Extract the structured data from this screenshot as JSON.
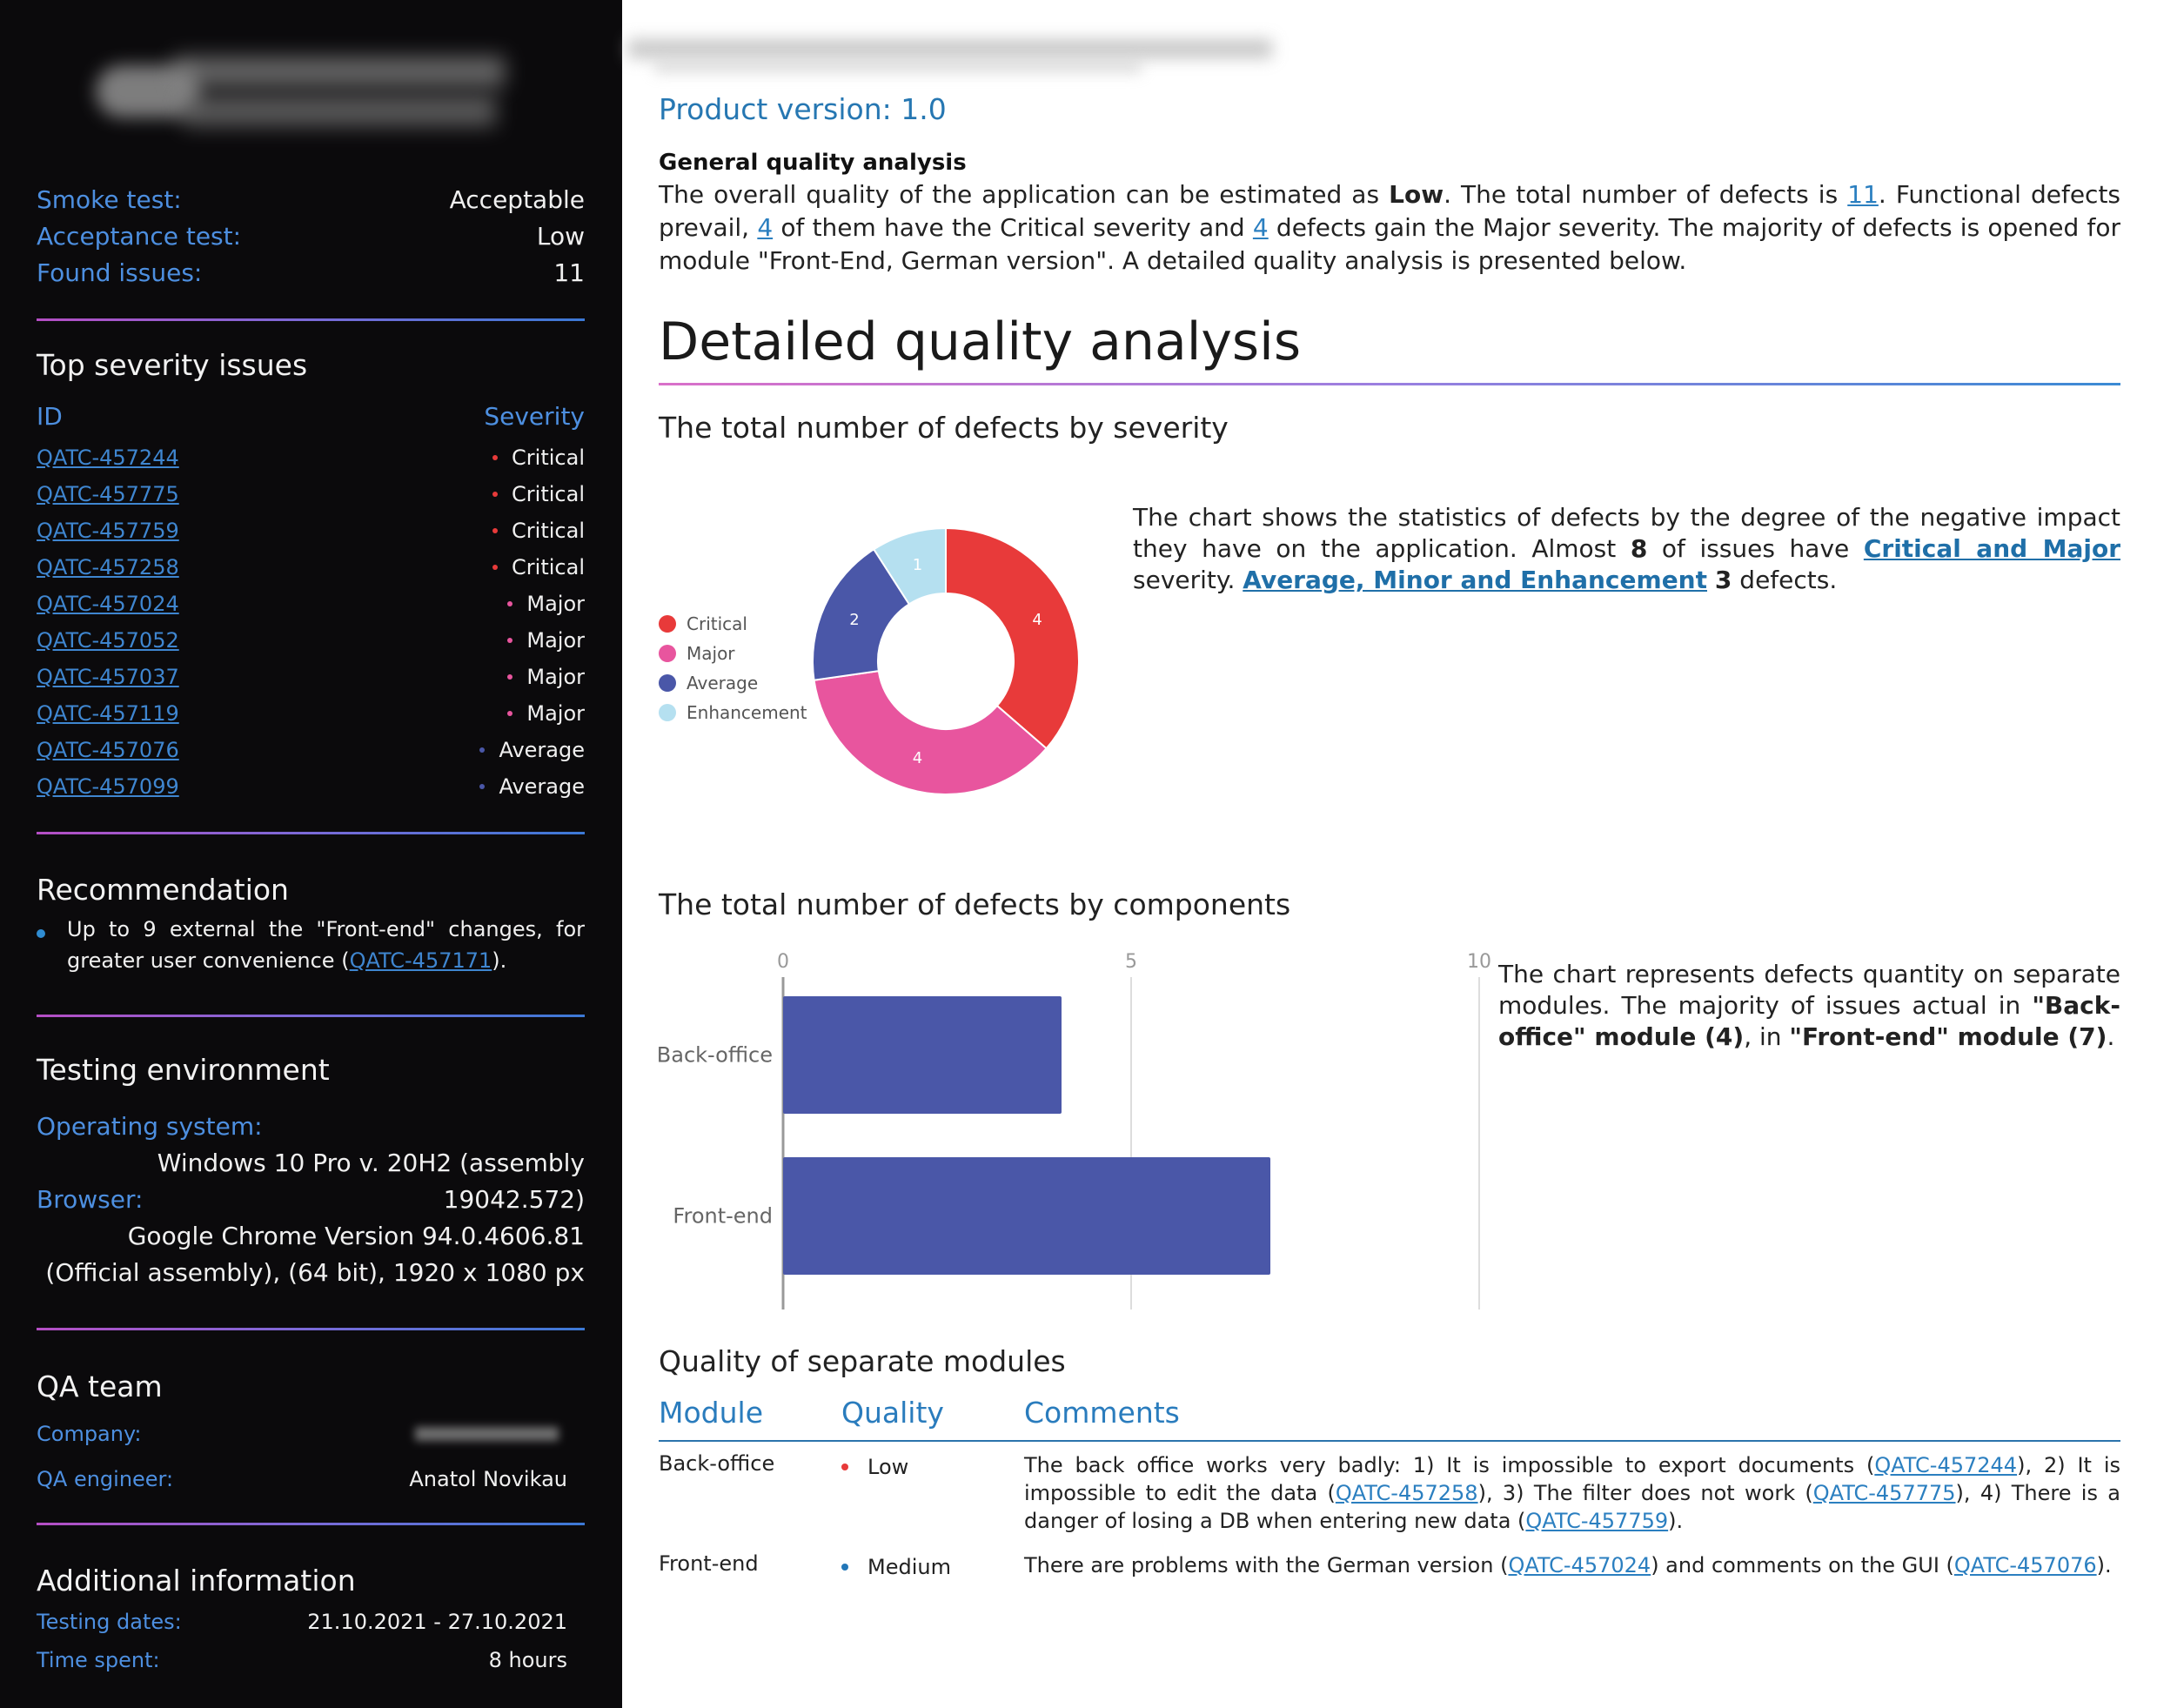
{
  "sidebar": {
    "smoke_test_label": "Smoke test:",
    "smoke_test_value": "Acceptable",
    "acceptance_test_label": "Acceptance test:",
    "acceptance_test_value": "Low",
    "found_issues_label": "Found issues:",
    "found_issues_value": "11",
    "top_severity_title": "Top severity issues",
    "col_id": "ID",
    "col_severity": "Severity",
    "issues": [
      {
        "id": "QATC-457244",
        "severity": "Critical",
        "color": "#e83a3a"
      },
      {
        "id": "QATC-457775",
        "severity": "Critical",
        "color": "#e83a3a"
      },
      {
        "id": "QATC-457759",
        "severity": "Critical",
        "color": "#e83a3a"
      },
      {
        "id": "QATC-457258",
        "severity": "Critical",
        "color": "#e83a3a"
      },
      {
        "id": "QATC-457024",
        "severity": "Major",
        "color": "#e8559e"
      },
      {
        "id": "QATC-457052",
        "severity": "Major",
        "color": "#e8559e"
      },
      {
        "id": "QATC-457037",
        "severity": "Major",
        "color": "#e8559e"
      },
      {
        "id": "QATC-457119",
        "severity": "Major",
        "color": "#e8559e"
      },
      {
        "id": "QATC-457076",
        "severity": "Average",
        "color": "#4a57a8"
      },
      {
        "id": "QATC-457099",
        "severity": "Average",
        "color": "#4a57a8"
      }
    ],
    "recommendation_title": "Recommendation",
    "recommendation_text": "Up to 9 external the \"Front-end\" changes, for greater user convenience (",
    "recommendation_link": "QATC-457171",
    "recommendation_tail": ").",
    "testing_env_title": "Testing environment",
    "os_label": "Operating system:",
    "os_value": "Windows 10 Pro v. 20H2 (assembly 19042.572)",
    "browser_label": "Browser:",
    "browser_value": "Google Chrome Version 94.0.4606.81 (Official assembly), (64 bit), 1920 x 1080 px",
    "qa_team_title": "QA team",
    "company_label": "Company:",
    "qa_engineer_label": "QA engineer:",
    "qa_engineer_value": "Anatol Novikau",
    "additional_title": "Additional information",
    "testing_dates_label": "Testing dates:",
    "testing_dates_value": "21.10.2021 - 27.10.2021",
    "time_spent_label": "Time spent:",
    "time_spent_value": "8 hours"
  },
  "main": {
    "product_version": "Product version: 1.0",
    "general_title": "General quality analysis",
    "general": {
      "t1": "The overall quality of the application can be estimated as ",
      "b1": "Low",
      "t2": ". The total number of defects is ",
      "l1": "11",
      "t3": ". Functional defects prevail, ",
      "l2": "4",
      "t4": " of them have the Critical severity and ",
      "l3": "4",
      "t5": " defects gain the Major severity. The majority of defects is opened for module \"Front-End, German version\". A detailed quality analysis is presented below."
    },
    "detailed_title": "Detailed quality analysis",
    "severity_section_title": "The total number of defects by severity",
    "severity_desc": {
      "t1": "The chart shows the statistics of defects by the degree of the negative impact they have on the application. Almost ",
      "b1": "8",
      "t2": " of issues have ",
      "l1": "Critical and Major",
      "t3": " severity. ",
      "l2": "Average, Minor and Enhancement",
      "t4": " ",
      "b2": "3",
      "t5": " defects."
    },
    "components_section_title": "The total number of defects by components",
    "components_desc": {
      "t1": "The chart represents defects quantity on separate modules. The majority of issues actual in ",
      "b1": "\"Back-office\" module (4)",
      "t2": ", in ",
      "b2": "\"Front-end\" module (7)",
      "t3": "."
    },
    "modules_section_title": "Quality of separate modules",
    "table": {
      "col_module": "Module",
      "col_quality": "Quality",
      "col_comments": "Comments",
      "rows": [
        {
          "module": "Back-office",
          "quality": "Low",
          "quality_color": "#e83a3a",
          "c1": "The back office works very badly: 1) It is impossible to export documents (",
          "l1": "QATC-457244",
          "c2": "), 2) It is impossible to edit the data (",
          "l2": "QATC-457258",
          "c3": "), 3) The filter does not work (",
          "l3": "QATC-457775",
          "c4": "), 4) There is a danger of losing a DB when entering new data (",
          "l4": "QATC-457759",
          "c5": ")."
        },
        {
          "module": "Front-end",
          "quality": "Medium",
          "quality_color": "#2377b8",
          "c1": "There are problems with the German version (",
          "l1": "QATC-457024",
          "c2": ") and comments on the GUI (",
          "l2": "QATC-457076",
          "c3": ")."
        }
      ]
    }
  },
  "chart_data": [
    {
      "type": "pie",
      "variant": "donut",
      "categories": [
        "Critical",
        "Major",
        "Average",
        "Enhancement"
      ],
      "values": [
        4,
        4,
        2,
        1
      ],
      "colors": [
        "#e83a3a",
        "#e8559e",
        "#4a57a8",
        "#b5e0f0"
      ],
      "legend_position": "left"
    },
    {
      "type": "bar",
      "orientation": "horizontal",
      "categories": [
        "Back-office",
        "Front-end"
      ],
      "values": [
        4,
        7
      ],
      "xlim": [
        0,
        10
      ],
      "ticks": [
        0,
        5,
        10
      ],
      "color": "#4a57a8",
      "grid": true
    }
  ]
}
